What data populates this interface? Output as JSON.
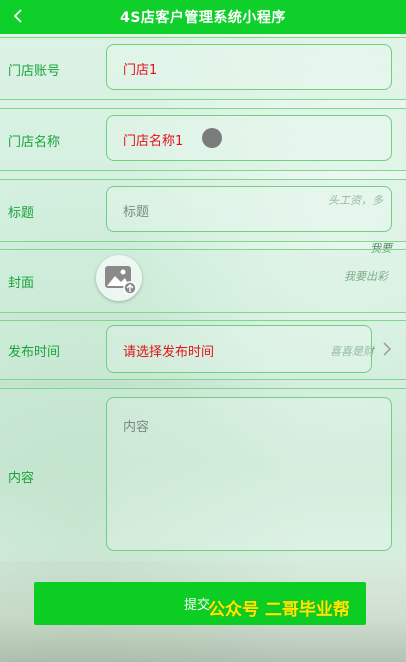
{
  "header": {
    "title": "4S店客户管理系统小程序"
  },
  "form": {
    "store_account": {
      "label": "门店账号",
      "value": "门店1"
    },
    "store_name": {
      "label": "门店名称",
      "value": "门店名称1"
    },
    "title": {
      "label": "标题",
      "placeholder": "标题"
    },
    "cover": {
      "label": "封面"
    },
    "publish_time": {
      "label": "发布时间",
      "placeholder": "请选择发布时间"
    },
    "content": {
      "label": "内容",
      "placeholder": "内容"
    }
  },
  "submit": {
    "label": "提交"
  },
  "watermark": "公众号 二哥毕业帮",
  "background_text": [
    "头工资，多",
    "我要",
    "我要出彩",
    "喜喜是财"
  ],
  "colors": {
    "header": "#0fcf2a",
    "label": "#1aa33a",
    "value": "#e0121a",
    "submit": "#0ccd24",
    "watermark": "#ffe600"
  }
}
